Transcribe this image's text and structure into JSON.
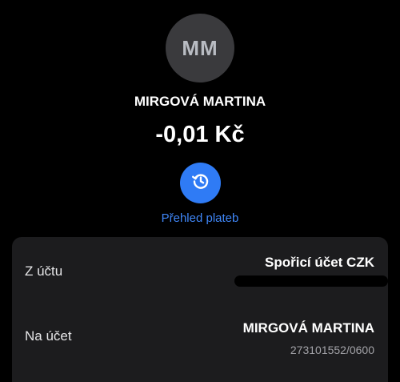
{
  "header": {
    "avatar_initials": "MM",
    "contact_name": "MIRGOVÁ MARTINA",
    "amount": "-0,01 Kč"
  },
  "actions": {
    "history_icon": "history-icon",
    "history_label": "Přehled plateb",
    "accent_color": "#2f7bf5"
  },
  "details": {
    "from": {
      "label": "Z účtu",
      "value": "Spořicí účet CZK"
    },
    "to": {
      "label": "Na účet",
      "name": "MIRGOVÁ MARTINA",
      "account_number": "273101552/0600"
    }
  }
}
